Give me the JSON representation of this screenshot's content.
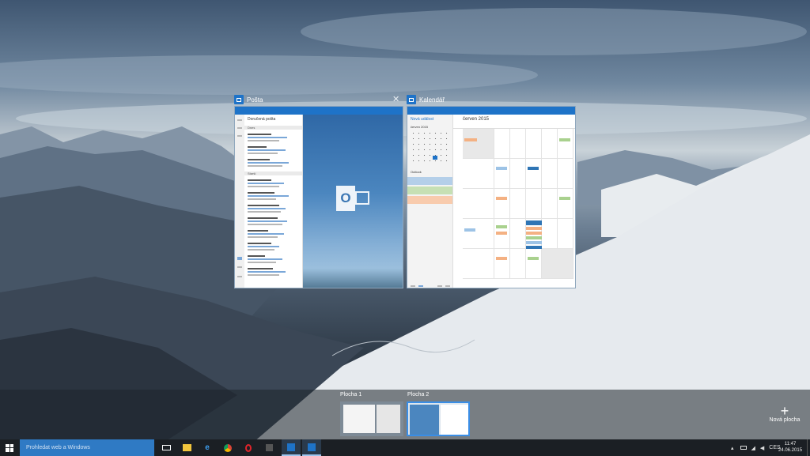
{
  "windows": [
    {
      "title": "Pošta",
      "icon": "mail-icon",
      "close": "✕"
    },
    {
      "title": "Kalendář",
      "icon": "calendar-icon"
    }
  ],
  "mail_app": {
    "list_header": "Doručená pošta",
    "sections": [
      "Dnes",
      "Starší"
    ]
  },
  "calendar_app": {
    "new_event": "Nová událost",
    "month": "červen 2015",
    "mini_month": "červen 2015",
    "calendars_title": "Outlook"
  },
  "desktops": [
    {
      "label": "Plocha 1",
      "active": false
    },
    {
      "label": "Plocha 2",
      "active": true
    }
  ],
  "new_desktop_label": "Nová plocha",
  "taskbar": {
    "search_placeholder": "Prohledat web a Windows",
    "language": "CES",
    "time": "11:47",
    "date": "24.06.2015"
  },
  "colors": {
    "accent": "#1e73c8",
    "search_box": "#2f7ac4",
    "taskbar": "#1b1f24"
  }
}
